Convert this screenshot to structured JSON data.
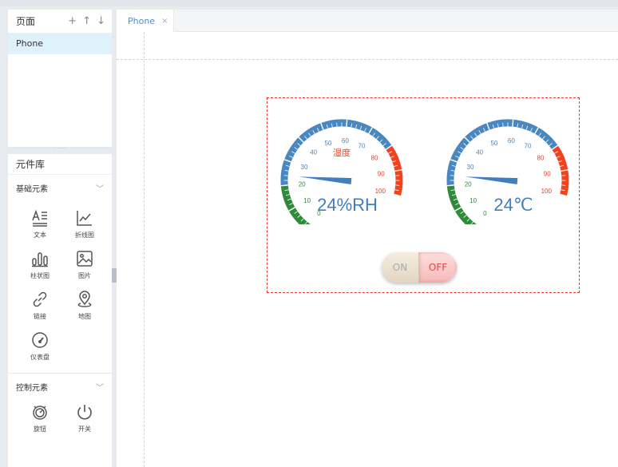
{
  "pages": {
    "title": "页面",
    "actions": [
      "+",
      "↑",
      "↓"
    ],
    "items": [
      {
        "label": "Phone",
        "selected": true
      }
    ]
  },
  "library": {
    "title": "元件库",
    "groups": [
      {
        "title": "基础元素",
        "expanded": true,
        "items": [
          {
            "label": "文本",
            "icon": "text-icon"
          },
          {
            "label": "折线图",
            "icon": "line-chart-icon"
          },
          {
            "label": "柱状图",
            "icon": "bar-chart-icon"
          },
          {
            "label": "图片",
            "icon": "image-icon"
          },
          {
            "label": "链接",
            "icon": "link-icon"
          },
          {
            "label": "地图",
            "icon": "map-pin-icon"
          },
          {
            "label": "仪表盘",
            "icon": "gauge-icon"
          }
        ]
      },
      {
        "title": "控制元素",
        "expanded": true,
        "items": [
          {
            "label": "旋钮",
            "icon": "knob-icon"
          },
          {
            "label": "开关",
            "icon": "power-icon"
          }
        ]
      }
    ]
  },
  "tabs": [
    {
      "label": "Phone",
      "close": "×",
      "active": true
    }
  ],
  "canvas": {
    "gauges": [
      {
        "title": "湿度",
        "value_text": "24%RH",
        "value": 24,
        "min": 0,
        "max": 100,
        "ticks": [
          "0",
          "10",
          "20",
          "30",
          "40",
          "50",
          "60",
          "70",
          "80",
          "90",
          "100"
        ],
        "colors": {
          "low": "#2e8b3a",
          "mid": "#4a86c0",
          "high": "#f0431f"
        }
      },
      {
        "title": "",
        "value_text": "24℃",
        "value": 24,
        "min": 0,
        "max": 100,
        "ticks": [
          "0",
          "10",
          "20",
          "30",
          "40",
          "50",
          "60",
          "70",
          "80",
          "90",
          "100"
        ],
        "colors": {
          "low": "#2e8b3a",
          "mid": "#4a86c0",
          "high": "#f0431f"
        }
      }
    ],
    "toggle": {
      "on_label": "ON",
      "off_label": "OFF",
      "state": "off"
    }
  }
}
